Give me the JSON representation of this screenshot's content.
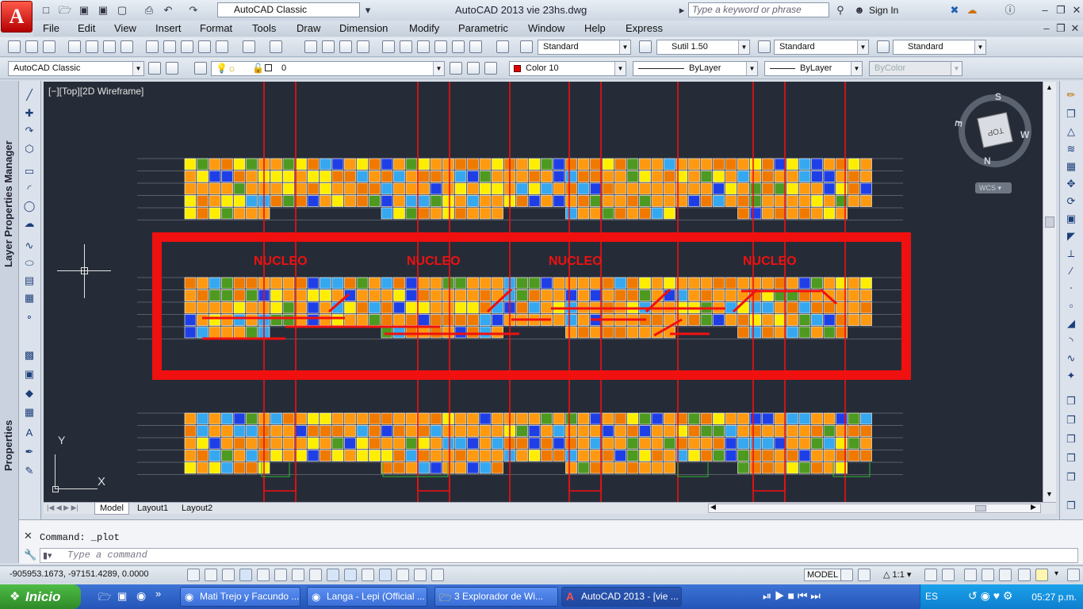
{
  "window": {
    "title": "AutoCAD 2013    vie 23hs.dwg",
    "workspace": "AutoCAD Classic",
    "search_placeholder": "Type a keyword or phrase",
    "sign_in": "Sign In"
  },
  "menu": [
    "File",
    "Edit",
    "View",
    "Insert",
    "Format",
    "Tools",
    "Draw",
    "Dimension",
    "Modify",
    "Parametric",
    "Window",
    "Help",
    "Express"
  ],
  "styles_toolbar": {
    "text_style": "Standard",
    "dim_style": "Sutil 1.50",
    "table_style": "Standard",
    "mleader_style": "Standard"
  },
  "layers_toolbar": {
    "workspace": "AutoCAD Classic",
    "layer": "0",
    "color": "Color 10",
    "linetype": "ByLayer",
    "lineweight": "ByLayer",
    "plotstyle": "ByColor"
  },
  "palettes": {
    "layer_manager": "Layer Properties Manager",
    "properties": "Properties"
  },
  "viewport": {
    "label": "[−][Top][2D Wireframe]",
    "labels": [
      "NUCLEO",
      "NUCLEO",
      "NUCLEO",
      "NUCLEO"
    ],
    "viewcube": {
      "top": "TOP",
      "n": "N",
      "s": "S",
      "e": "E",
      "w": "W",
      "wcs": "WCS"
    },
    "ucs": {
      "x": "X",
      "y": "Y"
    }
  },
  "layout_tabs": [
    "Model",
    "Layout1",
    "Layout2"
  ],
  "command": {
    "history": "Command: _plot",
    "placeholder": "Type a command"
  },
  "status": {
    "coords": "-905953.1673, -97151.4289, 0.0000",
    "model": "MODEL",
    "scale": "1:1"
  },
  "taskbar": {
    "start": "Inicio",
    "tasks": [
      "Mati Trejo y Facundo ...",
      "Langa - Lepi (Official ...",
      "3 Explorador de Wi...",
      "AutoCAD 2013 - [vie ..."
    ],
    "lang": "ES",
    "time": "05:27 p.m."
  },
  "colors": {
    "canvas": "#262c37",
    "red": "#f01010",
    "orange": "#ff9a10",
    "dark_orange": "#f07a00",
    "yellow": "#ffee00",
    "green": "#4e9a20",
    "blue": "#1f3fe6",
    "cyan": "#36a8f0"
  }
}
